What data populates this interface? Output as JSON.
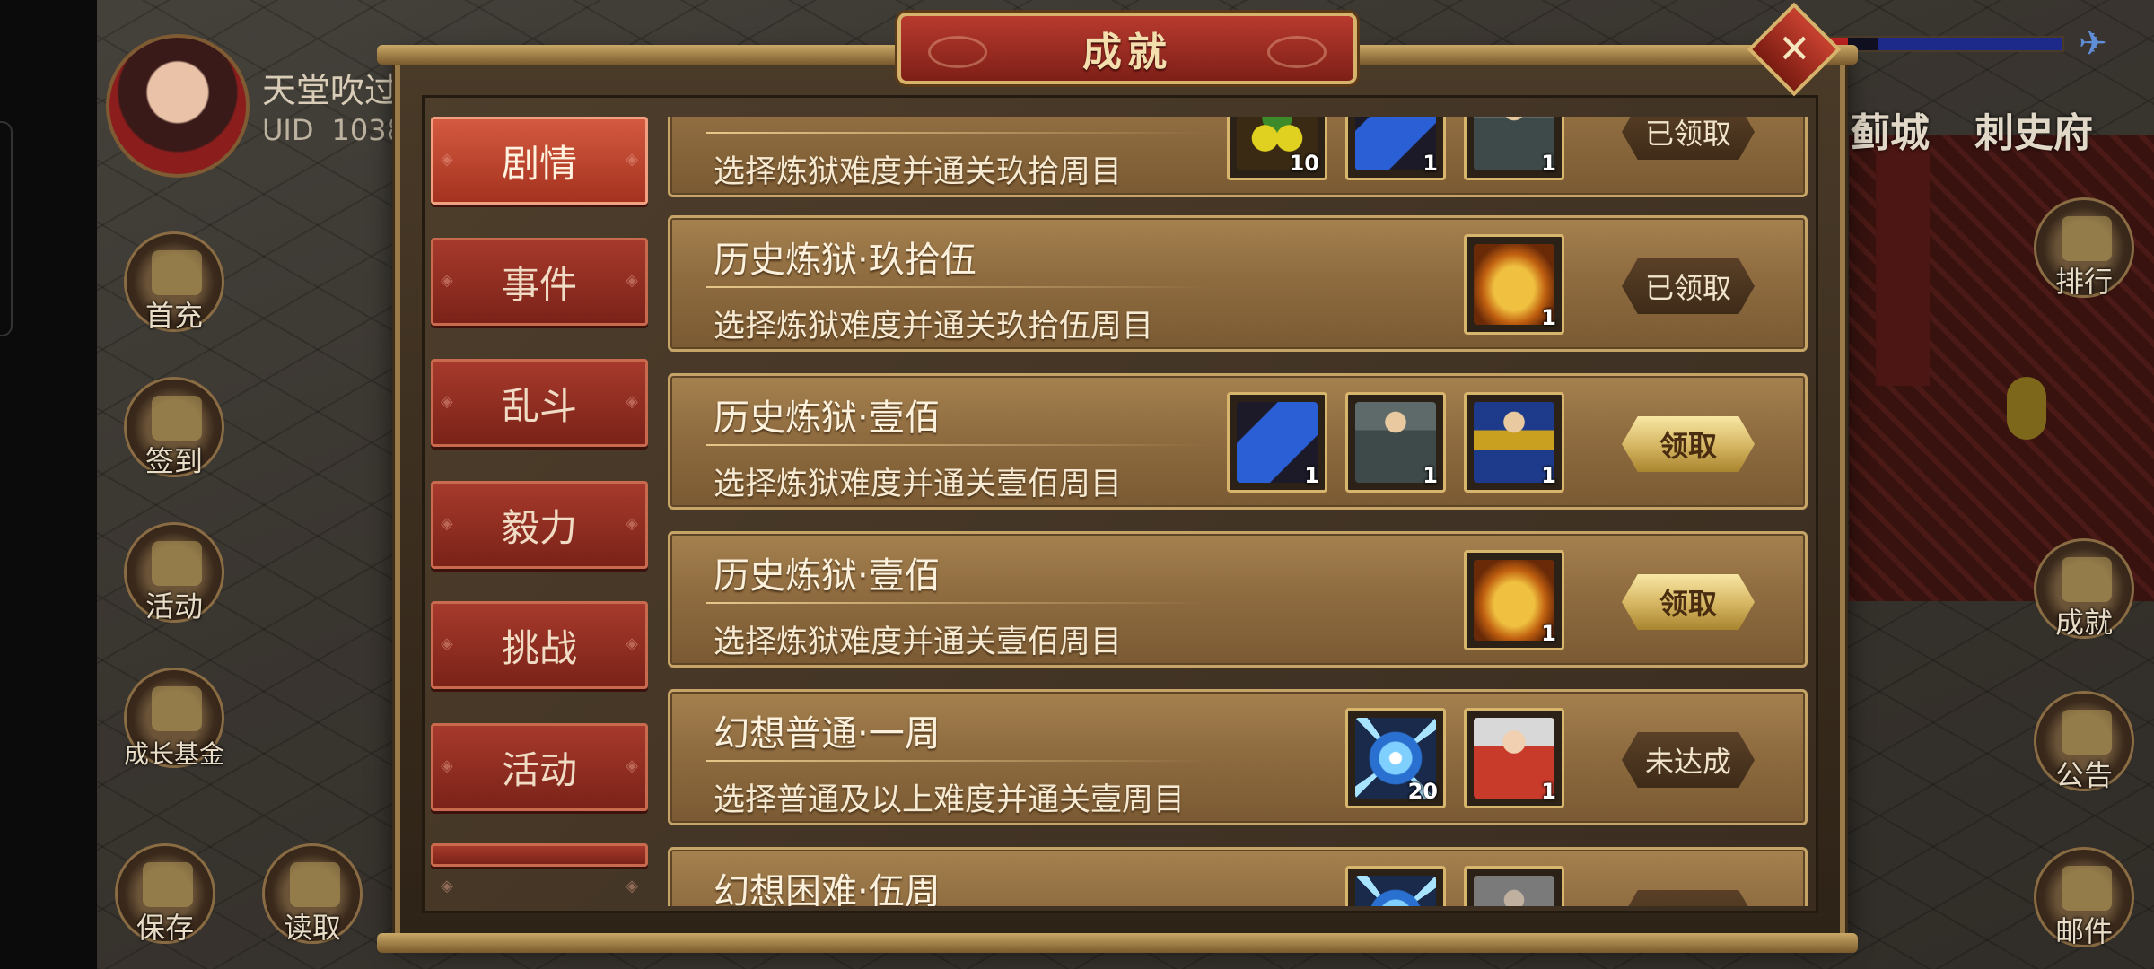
{
  "player": {
    "name": "天堂吹过",
    "uid_label": "UID",
    "uid_value": "1038"
  },
  "left_menu": [
    {
      "label": "首充",
      "icon": "gift-bag-icon"
    },
    {
      "label": "签到",
      "icon": "scroll-brush-icon"
    },
    {
      "label": "活动",
      "icon": "treasure-pile-icon"
    },
    {
      "label": "成长基金",
      "icon": "flower-icon"
    },
    {
      "label": "保存",
      "icon": "save-scroll-icon"
    },
    {
      "label": "读取",
      "icon": "load-scroll-icon"
    }
  ],
  "right_menu": [
    {
      "label": "排行",
      "icon": "ranking-plaque-icon"
    },
    {
      "label": "成就",
      "icon": "jade-seal-icon"
    },
    {
      "label": "公告",
      "icon": "bamboo-scroll-icon"
    },
    {
      "label": "邮件",
      "icon": "mail-icon"
    }
  ],
  "locations": [
    "蓟城",
    "刺史府"
  ],
  "dialog": {
    "title": "成就",
    "close_symbol": "✕",
    "tabs": [
      {
        "label": "剧情",
        "active": true
      },
      {
        "label": "事件",
        "active": false
      },
      {
        "label": "乱斗",
        "active": false
      },
      {
        "label": "毅力",
        "active": false
      },
      {
        "label": "挑战",
        "active": false
      },
      {
        "label": "活动",
        "active": false
      }
    ],
    "achievements": [
      {
        "title": "",
        "desc": "选择炼狱难度并通关玖拾周目",
        "rewards": [
          {
            "item": "fruit",
            "qty": "10"
          },
          {
            "item": "scroll",
            "qty": "1"
          },
          {
            "item": "hero",
            "qty": "1"
          }
        ],
        "status": "已领取",
        "status_type": "claimed"
      },
      {
        "title": "历史炼狱·玖拾伍",
        "desc": "选择炼狱难度并通关玖拾伍周目",
        "rewards": [
          {
            "item": "chest",
            "qty": "1"
          }
        ],
        "status": "已领取",
        "status_type": "claimed"
      },
      {
        "title": "历史炼狱·壹佰",
        "desc": "选择炼狱难度并通关壹佰周目",
        "rewards": [
          {
            "item": "scroll",
            "qty": "1"
          },
          {
            "item": "hero",
            "qty": "1"
          },
          {
            "item": "hero2",
            "qty": "1"
          }
        ],
        "status": "领取",
        "status_type": "claim"
      },
      {
        "title": "历史炼狱·壹佰",
        "desc": "选择炼狱难度并通关壹佰周目",
        "rewards": [
          {
            "item": "chest",
            "qty": "1"
          }
        ],
        "status": "领取",
        "status_type": "claim"
      },
      {
        "title": "幻想普通·一周",
        "desc": "选择普通及以上难度并通关壹周目",
        "rewards": [
          {
            "item": "crystal",
            "qty": "20"
          },
          {
            "item": "general",
            "qty": "1"
          }
        ],
        "status": "未达成",
        "status_type": "notyet"
      },
      {
        "title": "幻想困难·伍周",
        "desc": "",
        "rewards": [
          {
            "item": "crystal",
            "qty": ""
          },
          {
            "item": "warrior",
            "qty": ""
          }
        ],
        "status": "",
        "status_type": "notyet"
      }
    ]
  },
  "colors": {
    "tab_red": "#a63a2c",
    "row_gold": "#a5814f",
    "claim_gold": "#d4b460"
  }
}
